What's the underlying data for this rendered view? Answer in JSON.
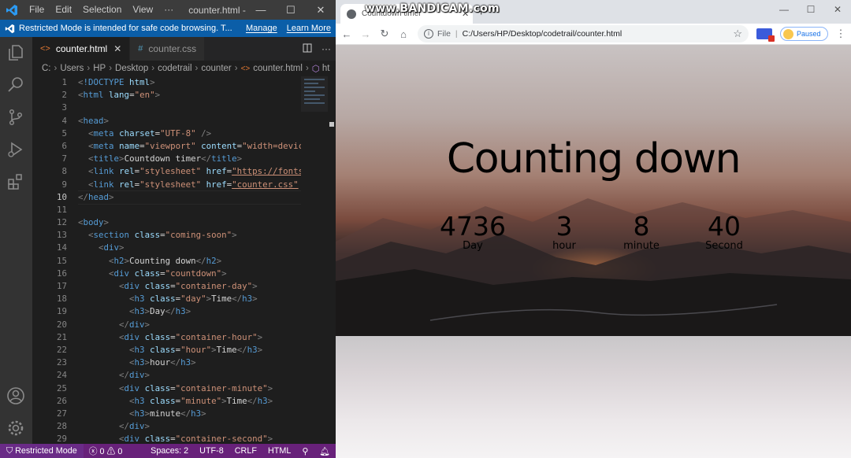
{
  "vscode": {
    "menu": [
      "File",
      "Edit",
      "Selection",
      "View",
      "···"
    ],
    "window_title": "counter.html - Vi...",
    "banner": {
      "text": "Restricted Mode is intended for safe code browsing. T...",
      "manage": "Manage",
      "learn_more": "Learn More"
    },
    "tabs": [
      {
        "icon": "<>",
        "label": "counter.html",
        "close": "✕"
      },
      {
        "icon": "#",
        "label": "counter.css"
      }
    ],
    "breadcrumb": [
      "C:",
      "Users",
      "HP",
      "Desktop",
      "codetrail",
      "counter",
      "counter.html",
      "ht"
    ],
    "line_numbers": [
      "1",
      "2",
      "3",
      "4",
      "5",
      "6",
      "7",
      "8",
      "9",
      "10",
      "11",
      "12",
      "13",
      "14",
      "15",
      "16",
      "17",
      "18",
      "19",
      "20",
      "21",
      "22",
      "23",
      "24",
      "25",
      "26",
      "27",
      "28",
      "29"
    ],
    "current_line": "10",
    "code_lines": [
      "<!DOCTYPE html>",
      "<html lang=\"en\">",
      "",
      "<head>",
      "  <meta charset=\"UTF-8\" />",
      "  <meta name=\"viewport\" content=\"width=devic",
      "  <title>Countdown timer</title>",
      "  <link rel=\"stylesheet\" href=\"https://fonts",
      "  <link rel=\"stylesheet\" href=\"counter.css\"",
      "</head>",
      "",
      "<body>",
      "  <section class=\"coming-soon\">",
      "    <div>",
      "      <h2>Counting down</h2>",
      "      <div class=\"countdown\">",
      "        <div class=\"container-day\">",
      "          <h3 class=\"day\">Time</h3>",
      "          <h3>Day</h3>",
      "        </div>",
      "        <div class=\"container-hour\">",
      "          <h3 class=\"hour\">Time</h3>",
      "          <h3>hour</h3>",
      "        </div>",
      "        <div class=\"container-minute\">",
      "          <h3 class=\"minute\">Time</h3>",
      "          <h3>minute</h3>",
      "        </div>",
      "        <div class=\"container-second\">"
    ],
    "status": {
      "restricted": "Restricted Mode",
      "problems": "ⓧ 0 ⚠ 0",
      "spaces": "Spaces: 2",
      "encoding": "UTF-8",
      "eol": "CRLF",
      "language": "HTML"
    },
    "accent_color": "#68217a",
    "banner_color": "#0b5ea8"
  },
  "chrome": {
    "tab_title": "Countdown timer",
    "watermark": "www.BANDICAM.com",
    "url_label": "File",
    "url": "C:/Users/HP/Desktop/codetrail/counter.html",
    "profile_status": "Paused"
  },
  "page": {
    "heading": "Counting down",
    "countdown": [
      {
        "value": "4736",
        "label": "Day"
      },
      {
        "value": "3",
        "label": "hour"
      },
      {
        "value": "8",
        "label": "minute"
      },
      {
        "value": "40",
        "label": "Second"
      }
    ]
  }
}
